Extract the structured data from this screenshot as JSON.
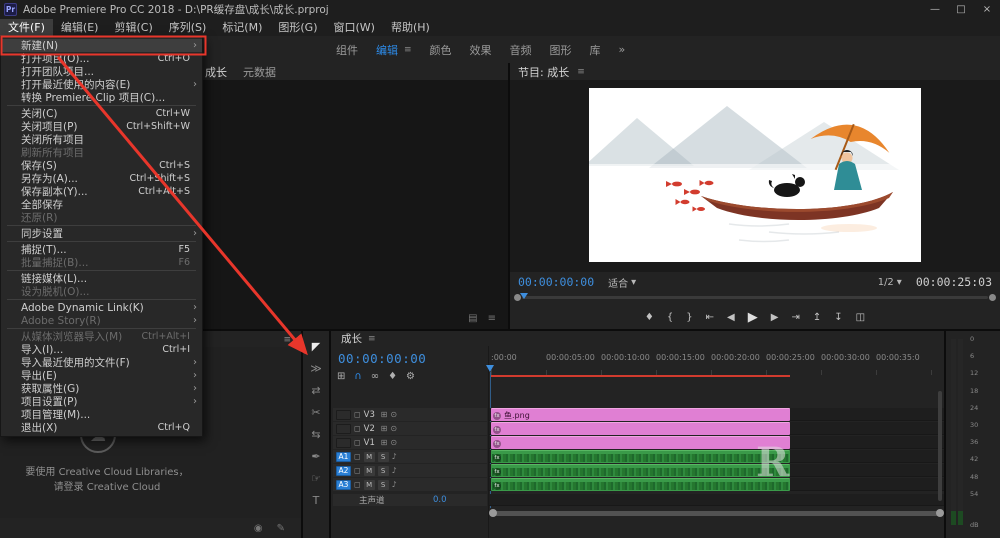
{
  "colors": {
    "accent_blue": "#2d8ceb",
    "annotation_red": "#e8362b",
    "clip_pink": "#e07fd3",
    "clip_green": "#3a9a49"
  },
  "titlebar": {
    "app_icon": "Pr",
    "title": "Adobe Premiere Pro CC 2018 - D:\\PR缓存盘\\成长\\成长.prproj",
    "minimize": "—",
    "maximize": "□",
    "close": "×"
  },
  "menubar": {
    "items": [
      {
        "label": "文件(F)"
      },
      {
        "label": "编辑(E)"
      },
      {
        "label": "剪辑(C)"
      },
      {
        "label": "序列(S)"
      },
      {
        "label": "标记(M)"
      },
      {
        "label": "图形(G)"
      },
      {
        "label": "窗口(W)"
      },
      {
        "label": "帮助(H)"
      }
    ]
  },
  "file_menu": {
    "items": [
      {
        "label": "新建(N)",
        "shortcut": "",
        "arrow": "›"
      },
      {
        "label": "打开项目(O)...",
        "shortcut": "Ctrl+O",
        "arrow": ""
      },
      {
        "label": "打开团队项目...",
        "shortcut": "",
        "arrow": ""
      },
      {
        "label": "打开最近使用的内容(E)",
        "shortcut": "",
        "arrow": "›"
      },
      {
        "label": "转换 Premiere Clip 项目(C)...",
        "shortcut": "",
        "arrow": ""
      },
      {
        "label": "关闭(C)",
        "shortcut": "Ctrl+W",
        "arrow": ""
      },
      {
        "label": "关闭项目(P)",
        "shortcut": "Ctrl+Shift+W",
        "arrow": ""
      },
      {
        "label": "关闭所有项目",
        "shortcut": "",
        "arrow": ""
      },
      {
        "label": "刷新所有项目",
        "shortcut": "",
        "arrow": ""
      },
      {
        "label": "保存(S)",
        "shortcut": "Ctrl+S",
        "arrow": ""
      },
      {
        "label": "另存为(A)...",
        "shortcut": "Ctrl+Shift+S",
        "arrow": ""
      },
      {
        "label": "保存副本(Y)...",
        "shortcut": "Ctrl+Alt+S",
        "arrow": ""
      },
      {
        "label": "全部保存",
        "shortcut": "",
        "arrow": ""
      },
      {
        "label": "还原(R)",
        "shortcut": "",
        "arrow": ""
      },
      {
        "label": "同步设置",
        "shortcut": "",
        "arrow": "›"
      },
      {
        "label": "捕捉(T)...",
        "shortcut": "F5",
        "arrow": ""
      },
      {
        "label": "批量捕捉(B)...",
        "shortcut": "F6",
        "arrow": ""
      },
      {
        "label": "链接媒体(L)...",
        "shortcut": "",
        "arrow": ""
      },
      {
        "label": "设为脱机(O)...",
        "shortcut": "",
        "arrow": ""
      },
      {
        "label": "Adobe Dynamic Link(K)",
        "shortcut": "",
        "arrow": "›"
      },
      {
        "label": "Adobe Story(R)",
        "shortcut": "",
        "arrow": "›"
      },
      {
        "label": "从媒体浏览器导入(M)",
        "shortcut": "Ctrl+Alt+I",
        "arrow": ""
      },
      {
        "label": "导入(I)...",
        "shortcut": "Ctrl+I",
        "arrow": ""
      },
      {
        "label": "导入最近使用的文件(F)",
        "shortcut": "",
        "arrow": "›"
      },
      {
        "label": "导出(E)",
        "shortcut": "",
        "arrow": "›"
      },
      {
        "label": "获取属性(G)",
        "shortcut": "",
        "arrow": "›"
      },
      {
        "label": "项目设置(P)",
        "shortcut": "",
        "arrow": "›"
      },
      {
        "label": "项目管理(M)...",
        "shortcut": "",
        "arrow": ""
      },
      {
        "label": "退出(X)",
        "shortcut": "Ctrl+Q",
        "arrow": ""
      }
    ]
  },
  "workspace": {
    "tabs": [
      {
        "label": "组件"
      },
      {
        "label": "编辑"
      },
      {
        "label": "颜色"
      },
      {
        "label": "效果"
      },
      {
        "label": "音频"
      },
      {
        "label": "图形"
      },
      {
        "label": "库"
      }
    ],
    "overflow": "»"
  },
  "source_panel": {
    "tabs": [
      {
        "label": "成长"
      },
      {
        "label": "元数据"
      }
    ],
    "corner_icons": [
      {
        "glyph": "▤"
      },
      {
        "glyph": "≡"
      }
    ]
  },
  "program": {
    "tab": "节目: 成长",
    "timecode": "00:00:00:00",
    "zoom_level": "适合",
    "playback_resolution": "1/2",
    "duration": "00:00:25:03",
    "transport": [
      {
        "name": "add-marker-icon",
        "glyph": "♦"
      },
      {
        "name": "mark-in-icon",
        "glyph": "{"
      },
      {
        "name": "mark-out-icon",
        "glyph": "}"
      },
      {
        "name": "go-to-in-icon",
        "glyph": "⇤"
      },
      {
        "name": "step-back-icon",
        "glyph": "◀"
      },
      {
        "name": "play-icon",
        "glyph": "▶"
      },
      {
        "name": "step-forward-icon",
        "glyph": "▶"
      },
      {
        "name": "go-to-out-icon",
        "glyph": "⇥"
      },
      {
        "name": "lift-icon",
        "glyph": "↥"
      },
      {
        "name": "extract-icon",
        "glyph": "↧"
      },
      {
        "name": "export-frame-icon",
        "glyph": "◫"
      }
    ]
  },
  "libraries": {
    "logo_glyph": "☁",
    "message_line1": "要使用 Creative Cloud Libraries，",
    "message_line2": "请登录 Creative Cloud",
    "bottom_icons": [
      {
        "glyph": "◉"
      },
      {
        "glyph": "✎"
      }
    ]
  },
  "tools": {
    "items": [
      {
        "name": "selection-tool",
        "glyph": "◤"
      },
      {
        "name": "track-select-tool",
        "glyph": "≫"
      },
      {
        "name": "ripple-edit-tool",
        "glyph": "⇄"
      },
      {
        "name": "razor-tool",
        "glyph": "✂"
      },
      {
        "name": "slip-tool",
        "glyph": "⇆"
      },
      {
        "name": "pen-tool",
        "glyph": "✒"
      },
      {
        "name": "hand-tool",
        "glyph": "☞"
      },
      {
        "name": "type-tool",
        "glyph": "T"
      }
    ]
  },
  "timeline": {
    "tab": "成长",
    "timecode": "00:00:00:00",
    "toolbar": [
      {
        "name": "nest-icon",
        "glyph": "⊞"
      },
      {
        "name": "snap-icon",
        "glyph": "∩"
      },
      {
        "name": "linked-selection-icon",
        "glyph": "∞"
      },
      {
        "name": "add-marker-icon",
        "glyph": "♦"
      },
      {
        "name": "timeline-settings-icon",
        "glyph": "⚙"
      }
    ],
    "ruler": [
      ":00:00",
      "00:00:05:00",
      "00:00:10:00",
      "00:00:15:00",
      "00:00:20:00",
      "00:00:25:00",
      "00:00:30:00",
      "00:00:35:0"
    ],
    "video_tracks": [
      {
        "name": "V3"
      },
      {
        "name": "V2"
      },
      {
        "name": "V1"
      }
    ],
    "audio_tracks": [
      {
        "patch": "A1"
      },
      {
        "patch": "A2"
      },
      {
        "patch": "A3"
      }
    ],
    "clip_label": "鱼.png",
    "master_label": "主声道",
    "master_value": "0.0"
  },
  "meter": {
    "labels": [
      "0",
      "6",
      "12",
      "18",
      "24",
      "30",
      "36",
      "42",
      "48",
      "54"
    ],
    "unit": "dB"
  },
  "watermark": "R",
  "glyphs": {
    "panel_menu": "≡",
    "caret": "▾",
    "lock": "◻",
    "sync_lock": "⊞",
    "eye": "⊙",
    "speaker": "♪",
    "mute": "M",
    "solo": "S",
    "fx": "fx"
  }
}
